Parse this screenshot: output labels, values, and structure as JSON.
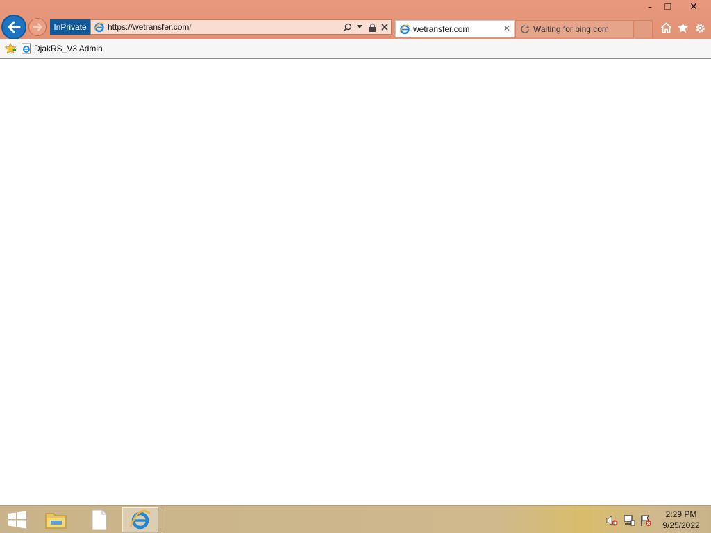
{
  "window": {
    "minimize_symbol": "–",
    "restore_symbol": "❐",
    "close_symbol": "✕"
  },
  "navigation": {
    "back_icon": "back-arrow-icon",
    "forward_icon": "forward-arrow-icon",
    "inprivate_label": "InPrivate",
    "address": {
      "scheme_host": "https://wetransfer.com",
      "path": "/"
    },
    "tools": [
      "search-icon",
      "dropdown-icon",
      "lock-icon",
      "stop-icon"
    ]
  },
  "tabs": [
    {
      "label": "wetransfer.com",
      "active": true,
      "close": "✕"
    },
    {
      "label": "Waiting for bing.com",
      "active": false
    }
  ],
  "command_icons": [
    "home-icon",
    "favorites-star-icon",
    "settings-gear-icon"
  ],
  "favorites_bar": {
    "items": [
      {
        "label": "DjakRS_V3 Admin",
        "icon": "ie-page-icon"
      }
    ]
  },
  "taskbar": {
    "items": [
      "windows-start",
      "file-explorer",
      "document",
      "internet-explorer"
    ],
    "tray": [
      "volume-muted-icon",
      "network-icon",
      "action-center-flag-icon"
    ],
    "clock": {
      "time": "2:29 PM",
      "date": "9/25/2022"
    }
  },
  "colors": {
    "titlebar": "#e29274",
    "inprivate": "#0e5a9a",
    "back_button": "#1b73c2",
    "taskbar": "#cfb88c"
  }
}
